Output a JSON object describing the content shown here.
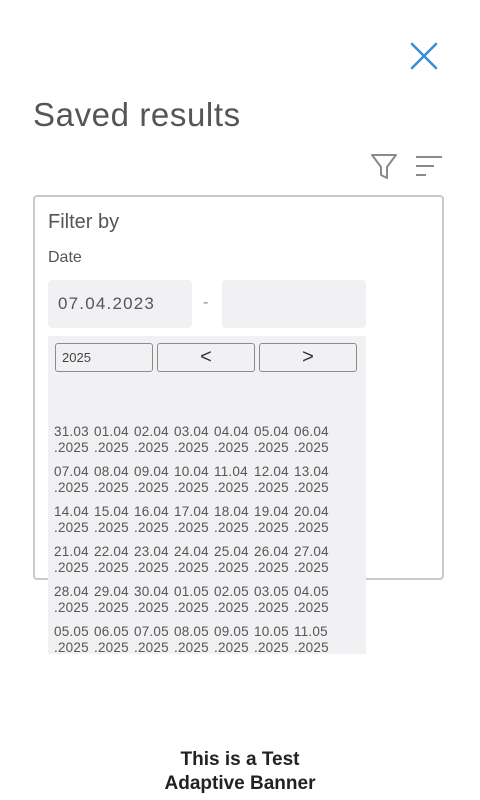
{
  "header": {
    "title": "Saved results"
  },
  "icons": {
    "close": "close-icon",
    "filter": "filter-funnel-icon",
    "sort": "sort-lines-icon"
  },
  "filter": {
    "heading": "Filter by",
    "date_label": "Date",
    "date_from": "07.04.2023",
    "date_to": "",
    "separator": "-"
  },
  "calendar": {
    "year": "2025",
    "prev_label": "<",
    "next_label": ">",
    "weeks": [
      [
        [
          "31.03",
          ".2025"
        ],
        [
          "01.04",
          ".2025"
        ],
        [
          "02.04",
          ".2025"
        ],
        [
          "03.04",
          ".2025"
        ],
        [
          "04.04",
          ".2025"
        ],
        [
          "05.04",
          ".2025"
        ],
        [
          "06.04",
          ".2025"
        ]
      ],
      [
        [
          "07.04",
          ".2025"
        ],
        [
          "08.04",
          ".2025"
        ],
        [
          "09.04",
          ".2025"
        ],
        [
          "10.04",
          ".2025"
        ],
        [
          "11.04",
          ".2025"
        ],
        [
          "12.04",
          ".2025"
        ],
        [
          "13.04",
          ".2025"
        ]
      ],
      [
        [
          "14.04",
          ".2025"
        ],
        [
          "15.04",
          ".2025"
        ],
        [
          "16.04",
          ".2025"
        ],
        [
          "17.04",
          ".2025"
        ],
        [
          "18.04",
          ".2025"
        ],
        [
          "19.04",
          ".2025"
        ],
        [
          "20.04",
          ".2025"
        ]
      ],
      [
        [
          "21.04",
          ".2025"
        ],
        [
          "22.04",
          ".2025"
        ],
        [
          "23.04",
          ".2025"
        ],
        [
          "24.04",
          ".2025"
        ],
        [
          "25.04",
          ".2025"
        ],
        [
          "26.04",
          ".2025"
        ],
        [
          "27.04",
          ".2025"
        ]
      ],
      [
        [
          "28.04",
          ".2025"
        ],
        [
          "29.04",
          ".2025"
        ],
        [
          "30.04",
          ".2025"
        ],
        [
          "01.05",
          ".2025"
        ],
        [
          "02.05",
          ".2025"
        ],
        [
          "03.05",
          ".2025"
        ],
        [
          "04.05",
          ".2025"
        ]
      ],
      [
        [
          "05.05",
          ".2025"
        ],
        [
          "06.05",
          ".2025"
        ],
        [
          "07.05",
          ".2025"
        ],
        [
          "08.05",
          ".2025"
        ],
        [
          "09.05",
          ".2025"
        ],
        [
          "10.05",
          ".2025"
        ],
        [
          "11.05",
          ".2025"
        ]
      ]
    ]
  },
  "banner": {
    "line1": "This is a Test",
    "line2": "Adaptive Banner"
  },
  "colors": {
    "accent": "#3a8fd8",
    "icon_gray": "#8a8a8a",
    "field_bg": "#f1f1f3",
    "border": "#c9c9c9"
  }
}
